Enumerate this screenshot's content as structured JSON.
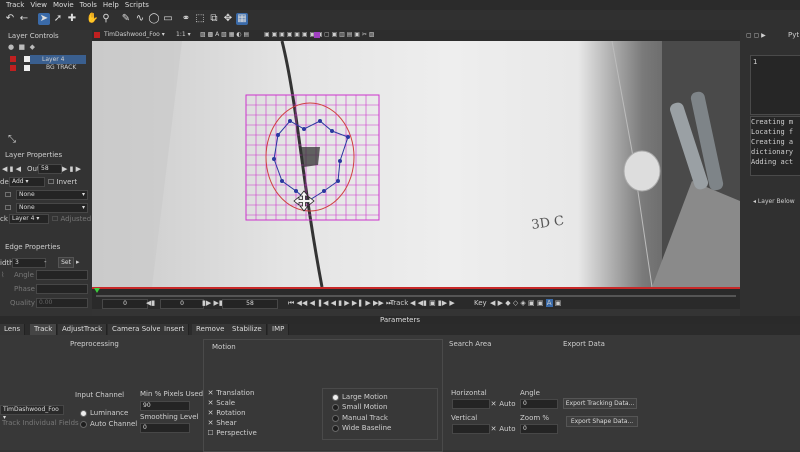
{
  "menu": [
    "Track",
    "View",
    "Movie",
    "Tools",
    "Help",
    "Scripts"
  ],
  "left": {
    "layer_controls_title": "Layer Controls",
    "layers": [
      "Layer 4",
      "BG TRACK"
    ],
    "layer_properties_title": "Layer Properties",
    "out_label": "Out",
    "out_value": "58",
    "blend_mode_prefix": "de",
    "blend_mode": "Add",
    "invert_label": "Invert",
    "none1": "None",
    "none2": "None",
    "track_prefix": "ck",
    "track_layer": "Layer 4",
    "adjusted_label": "Adjusted",
    "edge_title": "Edge Properties",
    "width_prefix": "idth",
    "width_value": "3",
    "set_label": "Set",
    "angle_label": "Angle",
    "phase_label": "Phase",
    "quality_label": "Quality",
    "quality_value": "0.00"
  },
  "viewer": {
    "clip_name": "TimDashwood_Foo",
    "zoom": "1:1",
    "overlay_text": "3D C"
  },
  "timeline": {
    "start": "0",
    "in": "0",
    "current": "58",
    "track_label": "Track",
    "key_label": "Key"
  },
  "right": {
    "title": "Pyt",
    "line_number": "1",
    "console": [
      "Creating m",
      "Locating f",
      "Creating a",
      "dictionary",
      "Adding act"
    ],
    "layer_below": "Layer Below"
  },
  "params_title": "Parameters",
  "tabs": [
    "Lens",
    "Track",
    "AdjustTrack",
    "Camera Solve",
    "Insert",
    "Remove",
    "Stabilize",
    "IMP"
  ],
  "active_tab": "Track",
  "bottom": {
    "preprocessing": "Preprocessing",
    "input_channel": "Input Channel",
    "luminance": "Luminance",
    "auto_channel": "Auto Channel",
    "clip_select": "TimDashwood_Foo",
    "track_individual": "Track Individual Fields",
    "min_pixels_label": "Min % Pixels Used",
    "min_pixels_value": "90",
    "smoothing_label": "Smoothing Level",
    "smoothing_value": "0",
    "motion_title": "Motion",
    "translation": "Translation",
    "scale": "Scale",
    "rotation": "Rotation",
    "shear": "Shear",
    "perspective": "Perspective",
    "large_motion": "Large Motion",
    "small_motion": "Small Motion",
    "manual_track": "Manual Track",
    "wide_baseline": "Wide Baseline",
    "search_area": "Search Area",
    "horizontal": "Horizontal",
    "vertical": "Vertical",
    "auto1": "Auto",
    "auto2": "Auto",
    "angle": "Angle",
    "angle_value": "0",
    "zoom_label": "Zoom %",
    "zoom_value": "0",
    "export_data": "Export Data",
    "export_tracking": "Export Tracking Data...",
    "export_shape": "Export Shape Data..."
  },
  "colors": {
    "accent": "#3a6aa8",
    "spline": "#cc33cc",
    "timeline_red": "#c82828"
  }
}
